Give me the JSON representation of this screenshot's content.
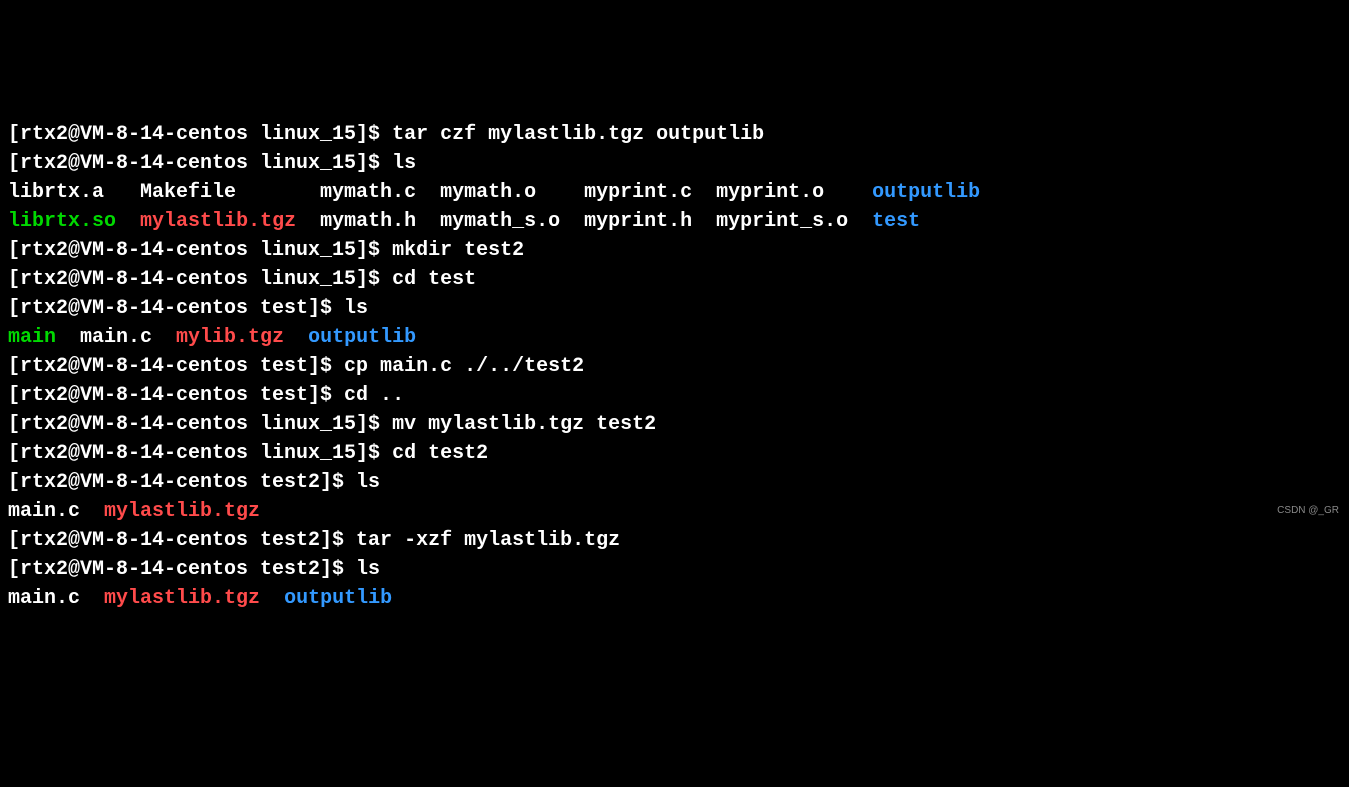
{
  "lines": [
    {
      "segments": [
        {
          "cls": "w",
          "text": "[rtx2@VM-8-14-centos linux_15]$ tar czf mylastlib.tgz outputlib"
        }
      ]
    },
    {
      "segments": [
        {
          "cls": "w",
          "text": "[rtx2@VM-8-14-centos linux_15]$ ls"
        }
      ]
    },
    {
      "segments": [
        {
          "cls": "w",
          "text": "librtx.a   Makefile       mymath.c  mymath.o    myprint.c  myprint.o    "
        },
        {
          "cls": "blue",
          "text": "outputlib"
        }
      ]
    },
    {
      "segments": [
        {
          "cls": "green",
          "text": "librtx.so"
        },
        {
          "cls": "w",
          "text": "  "
        },
        {
          "cls": "red",
          "text": "mylastlib.tgz"
        },
        {
          "cls": "w",
          "text": "  mymath.h  mymath_s.o  myprint.h  myprint_s.o  "
        },
        {
          "cls": "blue",
          "text": "test"
        }
      ]
    },
    {
      "segments": [
        {
          "cls": "w",
          "text": "[rtx2@VM-8-14-centos linux_15]$ mkdir test2"
        }
      ]
    },
    {
      "segments": [
        {
          "cls": "w",
          "text": "[rtx2@VM-8-14-centos linux_15]$ cd test"
        }
      ]
    },
    {
      "segments": [
        {
          "cls": "w",
          "text": "[rtx2@VM-8-14-centos test]$ ls"
        }
      ]
    },
    {
      "segments": [
        {
          "cls": "green",
          "text": "main"
        },
        {
          "cls": "w",
          "text": "  main.c  "
        },
        {
          "cls": "red",
          "text": "mylib.tgz"
        },
        {
          "cls": "w",
          "text": "  "
        },
        {
          "cls": "blue",
          "text": "outputlib"
        }
      ]
    },
    {
      "segments": [
        {
          "cls": "w",
          "text": "[rtx2@VM-8-14-centos test]$ cp main.c ./../test2"
        }
      ]
    },
    {
      "segments": [
        {
          "cls": "w",
          "text": "[rtx2@VM-8-14-centos test]$ cd .."
        }
      ]
    },
    {
      "segments": [
        {
          "cls": "w",
          "text": "[rtx2@VM-8-14-centos linux_15]$ mv mylastlib.tgz test2"
        }
      ]
    },
    {
      "segments": [
        {
          "cls": "w",
          "text": "[rtx2@VM-8-14-centos linux_15]$ cd test2"
        }
      ]
    },
    {
      "segments": [
        {
          "cls": "w",
          "text": "[rtx2@VM-8-14-centos test2]$ ls"
        }
      ]
    },
    {
      "segments": [
        {
          "cls": "w",
          "text": "main.c  "
        },
        {
          "cls": "red",
          "text": "mylastlib.tgz"
        }
      ]
    },
    {
      "segments": [
        {
          "cls": "w",
          "text": "[rtx2@VM-8-14-centos test2]$ tar -xzf mylastlib.tgz"
        }
      ]
    },
    {
      "segments": [
        {
          "cls": "w",
          "text": "[rtx2@VM-8-14-centos test2]$ ls"
        }
      ]
    },
    {
      "segments": [
        {
          "cls": "w",
          "text": "main.c  "
        },
        {
          "cls": "red",
          "text": "mylastlib.tgz"
        },
        {
          "cls": "w",
          "text": "  "
        },
        {
          "cls": "blue",
          "text": "outputlib"
        }
      ]
    }
  ],
  "watermark": "CSDN @_GR"
}
